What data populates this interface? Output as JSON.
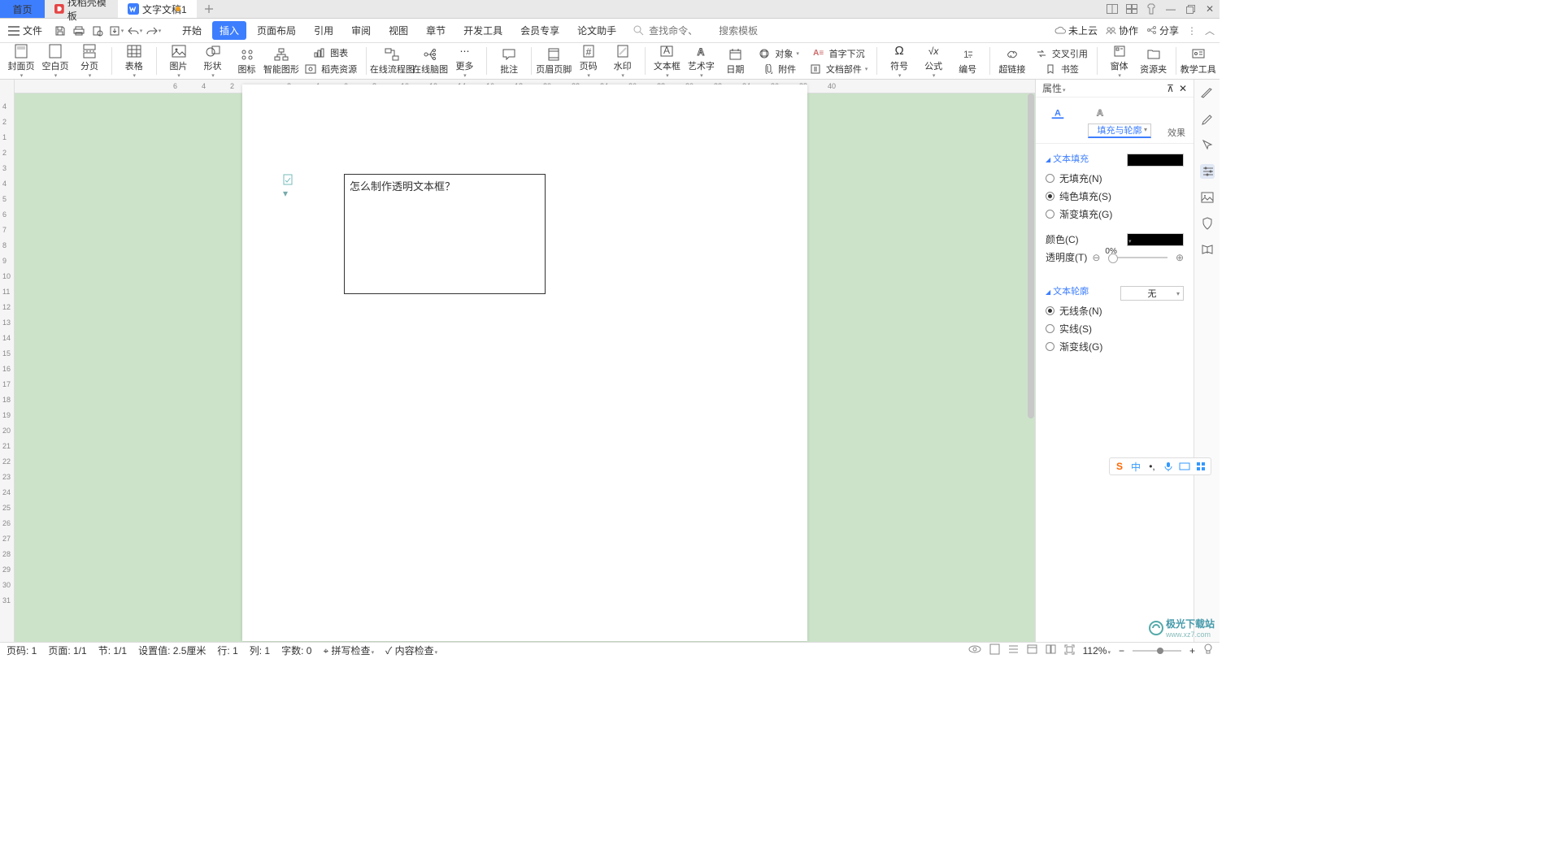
{
  "tabs": {
    "home": "首页",
    "template": "找稻壳模板",
    "doc": "文字文稿1"
  },
  "menu": {
    "file": "文件",
    "qat": {},
    "mtabs": [
      "开始",
      "插入",
      "页面布局",
      "引用",
      "审阅",
      "视图",
      "章节",
      "开发工具",
      "会员专享",
      "论文助手"
    ],
    "selected": 1,
    "search": {
      "cmd_ph": "查找命令、",
      "tpl_ph": "搜索模板"
    },
    "right": {
      "cloud": "未上云",
      "collab": "协作",
      "share": "分享"
    }
  },
  "ribbon": [
    "封面页",
    "空白页",
    "分页",
    "表格",
    "图片",
    "形状",
    "图标",
    "智能图形",
    "图表",
    "稻壳资源",
    "在线流程图",
    "在线脑图",
    "更多",
    "批注",
    "页眉页脚",
    "页码",
    "水印",
    "文本框",
    "艺术字",
    "日期",
    "对象",
    "附件",
    "首字下沉",
    "文档部件",
    "符号",
    "公式",
    "编号",
    "超链接",
    "交叉引用",
    "书签",
    "窗体",
    "资源夹",
    "教学工具"
  ],
  "textbox": {
    "content": "怎么制作透明文本框？"
  },
  "prop": {
    "title": "属性",
    "tabs": {
      "fill": "填充与轮廓",
      "effect": "效果"
    },
    "fill_section": "文本填充",
    "fill_opts": {
      "none": "无填充(N)",
      "solid": "纯色填充(S)",
      "grad": "渐变填充(G)"
    },
    "color_label": "颜色(C)",
    "opacity_label": "透明度(T)",
    "opacity_val": "0%",
    "outline_section": "文本轮廓",
    "outline_sel": "无",
    "outline_opts": {
      "none": "无线条(N)",
      "solid": "实线(S)",
      "grad": "渐变线(G)"
    }
  },
  "status": {
    "page_no": "页码: 1",
    "page": "页面: 1/1",
    "sec": "节: 1/1",
    "setval": "设置值: 2.5厘米",
    "row": "行: 1",
    "col": "列: 1",
    "words": "字数: 0",
    "spell": "拼写检查",
    "content": "内容检查",
    "zoom": "112%"
  },
  "ruler_h": [
    -6,
    -4,
    -2,
    2,
    4,
    6,
    8,
    10,
    12,
    14,
    16,
    18,
    20,
    22,
    24,
    26,
    28,
    30,
    32,
    34,
    36,
    38,
    40
  ],
  "ruler_v": [
    -4,
    -2,
    1,
    2,
    3,
    4,
    5,
    6,
    7,
    8,
    9,
    10,
    11,
    12,
    13,
    14,
    15,
    16,
    17,
    18,
    19,
    20,
    21,
    22,
    23,
    24,
    25,
    26,
    27,
    28,
    29,
    30,
    31
  ],
  "watermark": {
    "brand": "极光下载站",
    "url": "www.xz7.com"
  }
}
